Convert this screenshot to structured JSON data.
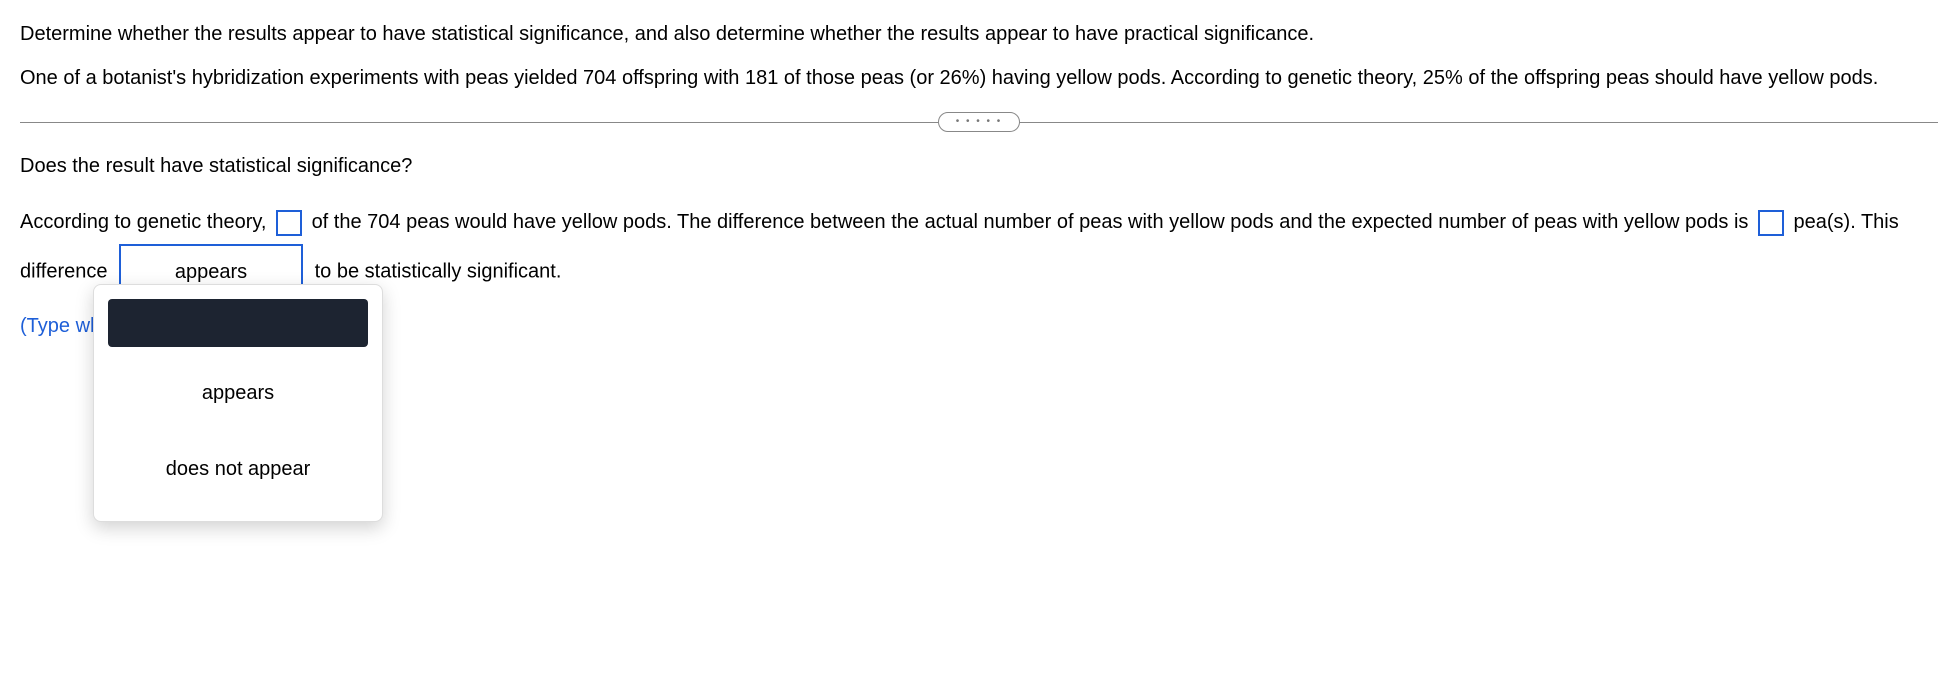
{
  "problem": {
    "line1": "Determine whether the results appear to have statistical significance, and also determine whether the results appear to have practical significance.",
    "line2": "One of a botanist's hybridization experiments with peas yielded 704 offspring with 181 of those peas (or 26%) having yellow pods. According to genetic theory, 25% of the offspring peas should have yellow pods."
  },
  "question": "Does the result have statistical significance?",
  "answer": {
    "part1_before": "According to genetic theory,",
    "part1_after": "of the 704 peas would have yellow pods. The difference between the actual number of peas with yellow pods and the expected number of peas with yellow pods is",
    "part2_after_pea": "pea(s). This difference",
    "part3_after_select": "to be statistically significant.",
    "hint": "(Type whole numbers.)"
  },
  "select": {
    "current": "appears",
    "options": {
      "blank": "",
      "opt1": "appears",
      "opt2": "does not appear"
    }
  },
  "divider_dots": "• • • • •"
}
